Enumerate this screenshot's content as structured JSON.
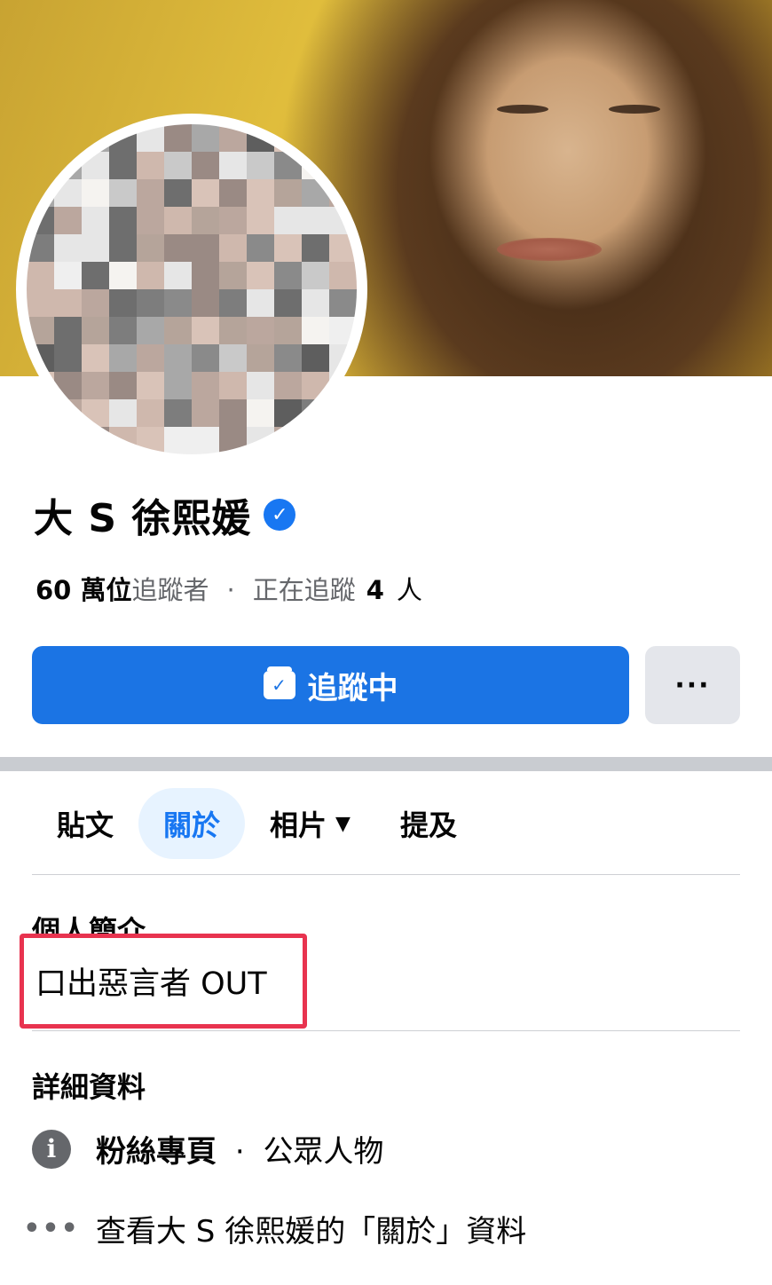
{
  "profile": {
    "name": "大 S 徐熙媛",
    "verified_icon": "check-icon"
  },
  "stats": {
    "followers_count": "60 萬位",
    "followers_label": "追蹤者",
    "separator": "·",
    "following_label": "正在追蹤",
    "following_count": "4",
    "following_unit": "人"
  },
  "actions": {
    "follow_label": "追蹤中",
    "more_label": "···"
  },
  "tabs": [
    {
      "label": "貼文"
    },
    {
      "label": "關於"
    },
    {
      "label": "相片"
    },
    {
      "label": "提及"
    }
  ],
  "bio": {
    "title": "個人簡介",
    "text": "口出惡言者 OUT"
  },
  "details": {
    "title": "詳細資料",
    "category_strong": "粉絲專頁",
    "category_sep": "·",
    "category_rest": "公眾人物",
    "about_link": "查看大 S 徐熙媛的「關於」資料"
  },
  "colors": {
    "accent": "#1b74e4",
    "highlight": "#e8334f"
  }
}
